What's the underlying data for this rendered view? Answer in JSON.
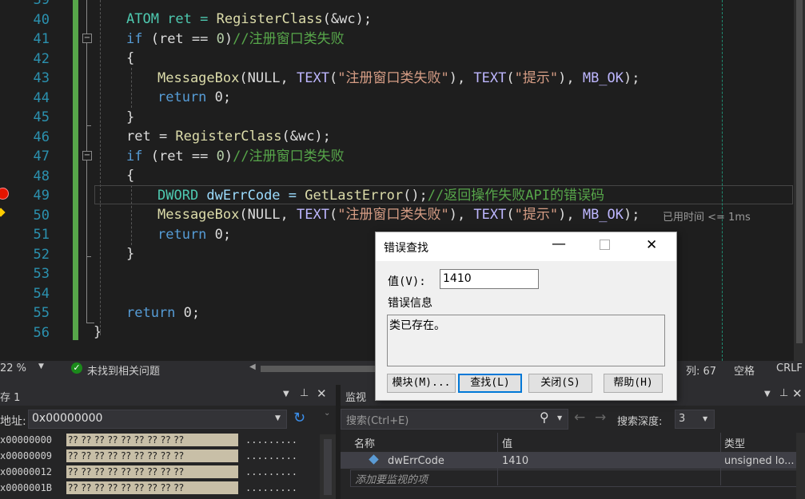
{
  "editor": {
    "lines": [
      {
        "n": "39"
      },
      {
        "n": "40"
      },
      {
        "n": "41"
      },
      {
        "n": "42"
      },
      {
        "n": "43"
      },
      {
        "n": "44"
      },
      {
        "n": "45"
      },
      {
        "n": "46"
      },
      {
        "n": "47"
      },
      {
        "n": "48"
      },
      {
        "n": "49"
      },
      {
        "n": "50"
      },
      {
        "n": "51"
      },
      {
        "n": "52"
      },
      {
        "n": "53"
      },
      {
        "n": "54"
      },
      {
        "n": "55"
      },
      {
        "n": "56"
      }
    ],
    "code": {
      "l40": {
        "a": "ATOM ret = ",
        "b": "RegisterClass",
        "c": "(&wc);"
      },
      "l41": {
        "a": "if",
        "b": " (ret == ",
        "c": "0",
        "d": ")",
        "e": "//注册窗口类失败"
      },
      "l42": "{",
      "l43": {
        "a": "MessageBox",
        "b": "(NULL, ",
        "c": "TEXT",
        "d": "(",
        "e": "\"注册窗口类失败\"",
        "f": "), ",
        "g": "TEXT",
        "h": "(",
        "i": "\"提示\"",
        "j": "), ",
        "k": "MB_OK",
        "l": ");"
      },
      "l44": {
        "a": "return",
        "b": " 0;"
      },
      "l45": "}",
      "l46": {
        "a": "ret = ",
        "b": "RegisterClass",
        "c": "(&wc);"
      },
      "l47": {
        "a": "if",
        "b": " (ret == ",
        "c": "0",
        "d": ")",
        "e": "//注册窗口类失败"
      },
      "l48": "{",
      "l49": {
        "a": "DWORD",
        "b": " dwErrCode = ",
        "c": "GetLastError",
        "d": "();",
        "e": "//返回操作失败API的错误码"
      },
      "l50": {
        "a": "MessageBox",
        "b": "(NULL, ",
        "c": "TEXT",
        "d": "(",
        "e": "\"注册窗口类失败\"",
        "f": "), ",
        "g": "TEXT",
        "h": "(",
        "i": "\"提示\"",
        "j": "), ",
        "k": "MB_OK",
        "l": ");",
        "hint": "已用时间 <= 1ms"
      },
      "l51": {
        "a": "return",
        "b": " 0;"
      },
      "l52": "}",
      "l55": {
        "a": "return",
        "b": " 0;"
      },
      "l56": "}"
    }
  },
  "status": {
    "zoom": "22 %",
    "issues": "未找到相关问题",
    "col": "列: 67",
    "space": "空格",
    "eol": "CRLF"
  },
  "memory": {
    "title": "存 1",
    "addr_label": "地址:",
    "addr_value": "0x00000000",
    "rows": [
      {
        "addr": "x00000000",
        "hex": "?? ?? ?? ?? ?? ?? ?? ?? ??",
        "ascii": "........."
      },
      {
        "addr": "x00000009",
        "hex": "?? ?? ?? ?? ?? ?? ?? ?? ??",
        "ascii": "........."
      },
      {
        "addr": "x00000012",
        "hex": "?? ?? ?? ?? ?? ?? ?? ?? ??",
        "ascii": "........."
      },
      {
        "addr": "x0000001B",
        "hex": "?? ?? ?? ?? ?? ?? ?? ?? ??",
        "ascii": "........."
      }
    ]
  },
  "watch": {
    "title": "监视",
    "search_placeholder": "搜索(Ctrl+E)",
    "depth_label": "搜索深度:",
    "depth_value": "3",
    "col_name": "名称",
    "col_value": "值",
    "col_type": "类型",
    "row_name": "dwErrCode",
    "row_value": "1410",
    "row_type": "unsigned lo...",
    "add_hint": "添加要监视的项"
  },
  "dialog": {
    "title": "错误查找",
    "value_label": "值(V):",
    "value": "1410",
    "info_label": "错误信息",
    "message": "类已存在。",
    "btn_module": "模块(M)...",
    "btn_find": "查找(L)",
    "btn_close": "关闭(S)",
    "btn_help": "帮助(H)"
  }
}
